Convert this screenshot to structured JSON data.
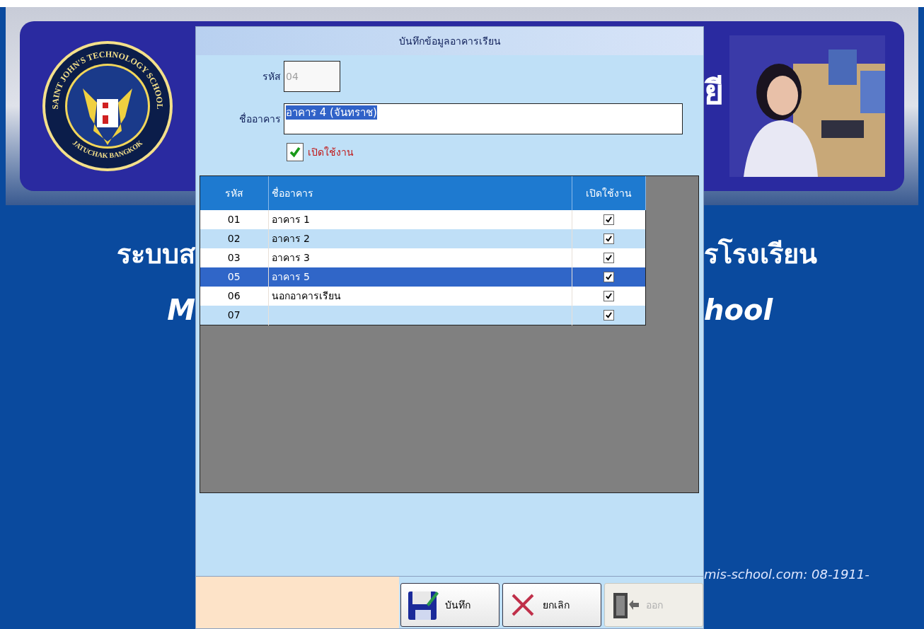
{
  "background": {
    "banner_text": "ยี",
    "title_left": "ระบบส",
    "title_right": "รโรงเรียน",
    "subtitle_left": "M",
    "subtitle_right": "hool",
    "footer": "mis-school.com: 08-1911-"
  },
  "logo": {
    "top_text": "SAINT JOHN'S TECHNOLOGY SCHOOL",
    "bottom_text": "JATUCHAK BANGKOK"
  },
  "dialog": {
    "title": "บันทึกข้อมูลอาคารเรียน",
    "code": {
      "label": "รหัส",
      "value": "04",
      "disabled": true
    },
    "name": {
      "label": "ชื่ออาคาร",
      "value": "อาคาร 4 (จันทราช)",
      "highlighted": true
    },
    "enabled": {
      "label": "เปิดใช้งาน",
      "checked": true
    },
    "table": {
      "columns": [
        "รหัส",
        "ชื่ออาคาร",
        "เปิดใช้งาน"
      ],
      "rows": [
        {
          "code": "01",
          "name": "อาคาร 1",
          "enabled": true,
          "selected": false
        },
        {
          "code": "02",
          "name": "อาคาร 2",
          "enabled": true,
          "selected": false
        },
        {
          "code": "03",
          "name": "อาคาร 3",
          "enabled": true,
          "selected": false
        },
        {
          "code": "05",
          "name": "อาคาร 5",
          "enabled": true,
          "selected": true
        },
        {
          "code": "06",
          "name": "นอกอาคารเรียน",
          "enabled": true,
          "selected": false
        },
        {
          "code": "07",
          "enabled": true,
          "selected": false
        }
      ]
    },
    "buttons": [
      {
        "kind": "save",
        "label": "บันทึก",
        "disabled": false
      },
      {
        "kind": "cancel",
        "label": "ยกเลิก",
        "disabled": false
      },
      {
        "kind": "exit",
        "label": "ออก",
        "disabled": true
      }
    ]
  }
}
